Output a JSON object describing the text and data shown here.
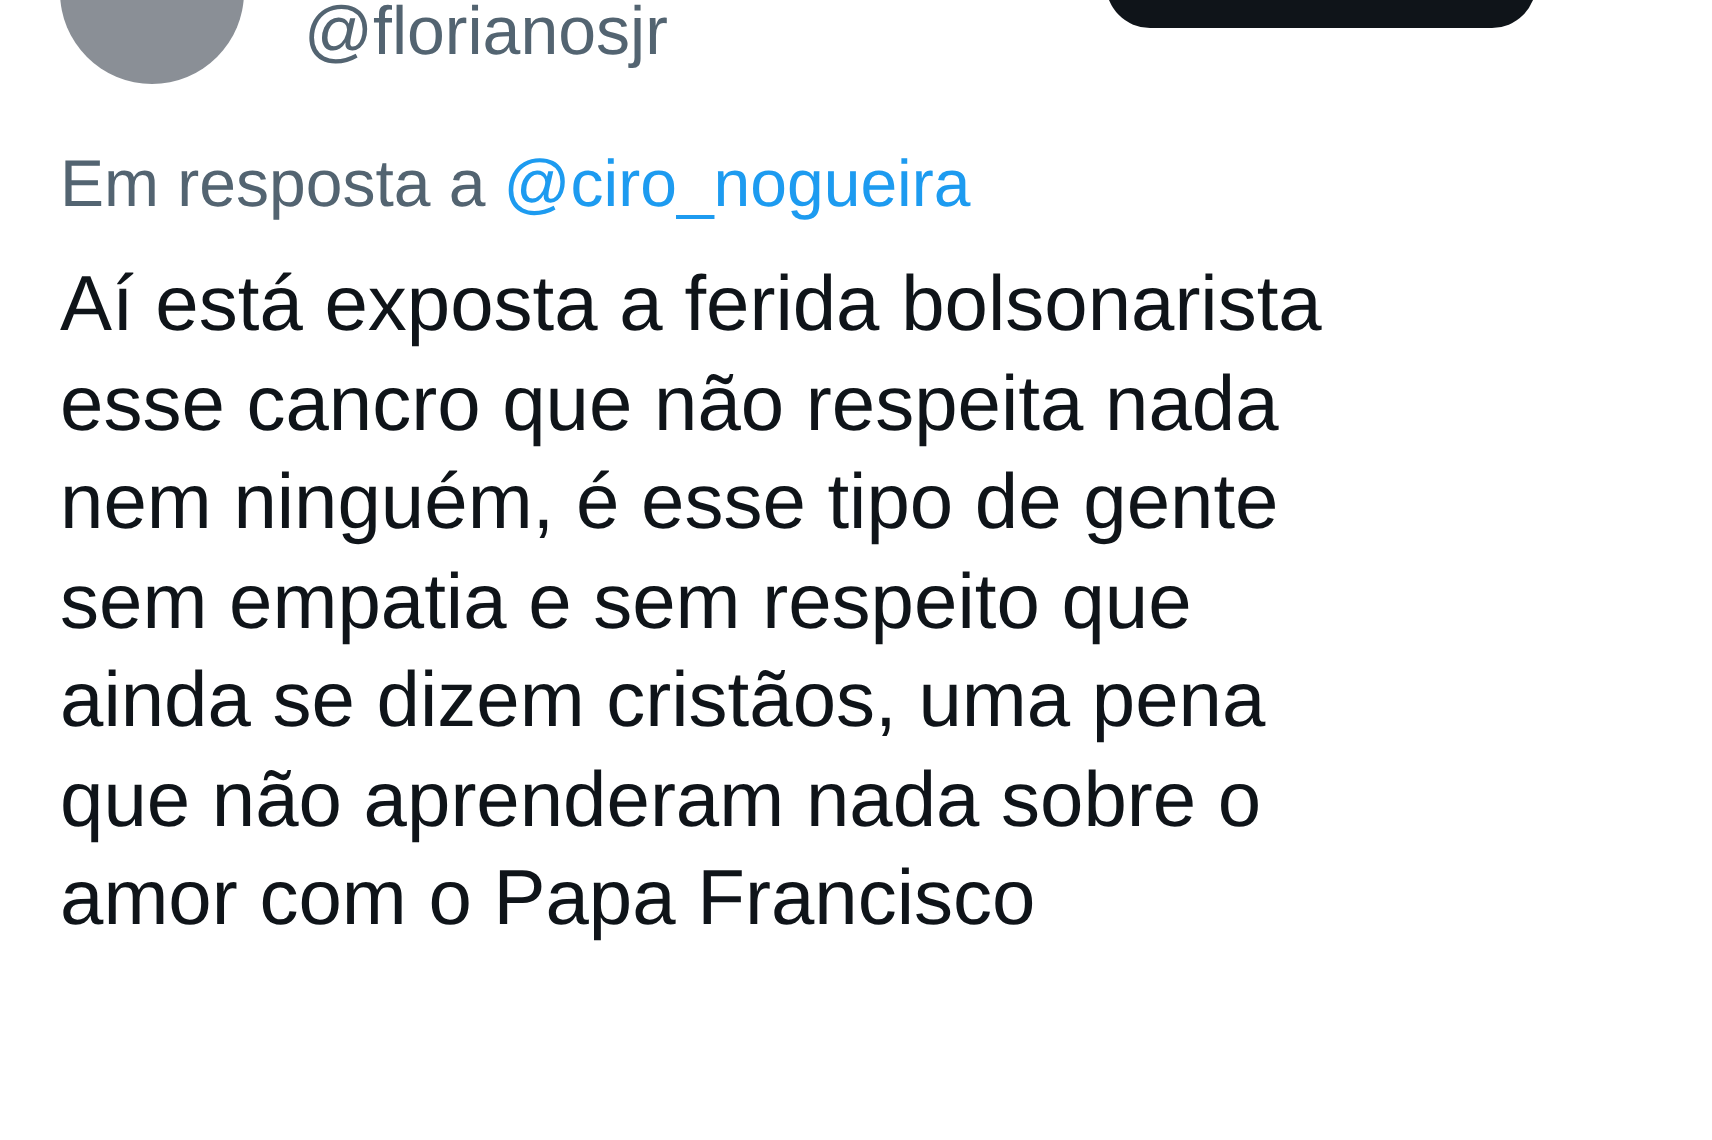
{
  "author": {
    "handle": "@florianosjr"
  },
  "reply_to": {
    "prefix": "Em resposta a",
    "mention": "@ciro_nogueira"
  },
  "tweet": {
    "text": "Aí está exposta a ferida bolsonarista\nesse cancro que não respeita nada\nnem ninguém, é esse tipo de gente\nsem empatia e sem respeito que\nainda se dizem cristãos, uma pena\nque não aprenderam nada sobre o\namor com o Papa Francisco"
  }
}
